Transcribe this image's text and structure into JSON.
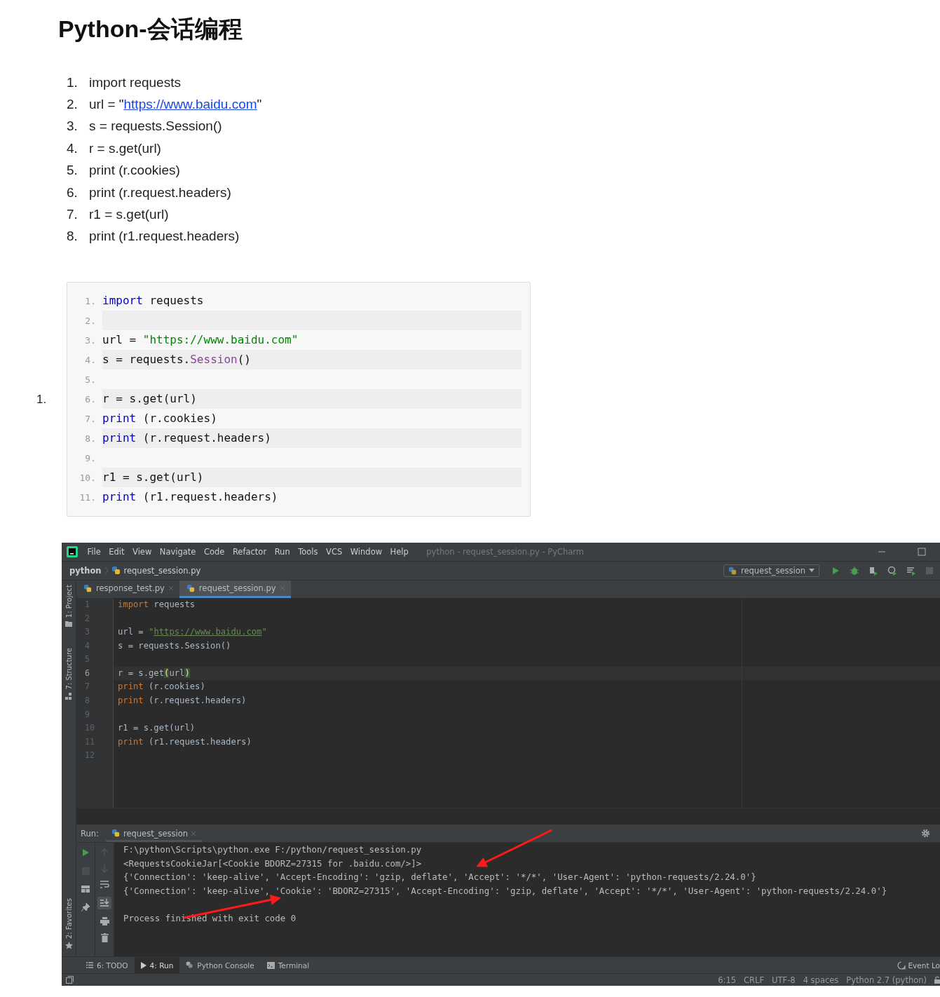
{
  "title": "Python-会话编程",
  "steps": [
    {
      "number": "1.",
      "parts": [
        {
          "kind": "text",
          "text": "import requests"
        }
      ]
    },
    {
      "number": "2.",
      "parts": [
        {
          "kind": "text",
          "text": "url = \""
        },
        {
          "kind": "link",
          "text": "https://www.baidu.com"
        },
        {
          "kind": "text",
          "text": "\""
        }
      ]
    },
    {
      "number": "3.",
      "parts": [
        {
          "kind": "text",
          "text": "s = requests.Session()"
        }
      ]
    },
    {
      "number": "4.",
      "parts": [
        {
          "kind": "text",
          "text": "r = s.get(url)"
        }
      ]
    },
    {
      "number": "5.",
      "parts": [
        {
          "kind": "text",
          "text": "print (r.cookies)"
        }
      ]
    },
    {
      "number": "6.",
      "parts": [
        {
          "kind": "text",
          "text": "print (r.request.headers)"
        }
      ]
    },
    {
      "number": "7.",
      "parts": [
        {
          "kind": "text",
          "text": "r1 = s.get(url)"
        }
      ]
    },
    {
      "number": "8.",
      "parts": [
        {
          "kind": "text",
          "text": "print (r1.request.headers)"
        }
      ]
    }
  ],
  "code_item": {
    "number": "1.",
    "lines": [
      {
        "number": "1.",
        "tokens": [
          {
            "kind": "keyword",
            "text": "import"
          },
          {
            "kind": "plain",
            "text": " requests"
          }
        ]
      },
      {
        "number": "2."
      },
      {
        "number": "3.",
        "tokens": [
          {
            "kind": "plain",
            "text": "url = "
          },
          {
            "kind": "string",
            "text": "\"https://www.baidu.com\""
          }
        ]
      },
      {
        "number": "4.",
        "tokens": [
          {
            "kind": "plain",
            "text": "s = requests."
          },
          {
            "kind": "func",
            "text": "Session"
          },
          {
            "kind": "plain",
            "text": "()"
          }
        ]
      },
      {
        "number": "5."
      },
      {
        "number": "6.",
        "tokens": [
          {
            "kind": "plain",
            "text": "r = s.get(url)"
          }
        ]
      },
      {
        "number": "7.",
        "tokens": [
          {
            "kind": "keyword",
            "text": "print"
          },
          {
            "kind": "plain",
            "text": " (r.cookies)"
          }
        ]
      },
      {
        "number": "8.",
        "tokens": [
          {
            "kind": "keyword",
            "text": "print"
          },
          {
            "kind": "plain",
            "text": " (r.request.headers)"
          }
        ]
      },
      {
        "number": "9."
      },
      {
        "number": "10.",
        "tokens": [
          {
            "kind": "plain",
            "text": "r1 = s.get(url)"
          }
        ]
      },
      {
        "number": "11.",
        "tokens": [
          {
            "kind": "keyword",
            "text": "print"
          },
          {
            "kind": "plain",
            "text": " (r1.request.headers)"
          }
        ]
      }
    ]
  },
  "ide": {
    "menu": [
      "File",
      "Edit",
      "View",
      "Navigate",
      "Code",
      "Refactor",
      "Run",
      "Tools",
      "VCS",
      "Window",
      "Help"
    ],
    "window_title": "python - request_session.py - PyCharm",
    "breadcrumb": {
      "project": "python",
      "file": "request_session.py"
    },
    "run_config": "request_session",
    "tabs": [
      {
        "label": "response_test.py",
        "selected": false
      },
      {
        "label": "request_session.py",
        "selected": true
      }
    ],
    "left_tools": [
      {
        "label": "1: Project",
        "kind": "project"
      },
      {
        "label": "7: Structure",
        "kind": "structure"
      },
      {
        "label": "2: Favorites",
        "kind": "favorites"
      }
    ],
    "editor_lines": [
      {
        "number": "1",
        "current": false,
        "tokens": [
          {
            "kind": "keyword",
            "text": "import"
          },
          {
            "kind": "plain",
            "text": " requests"
          }
        ]
      },
      {
        "number": "2",
        "current": false
      },
      {
        "number": "3",
        "current": false,
        "tokens": [
          {
            "kind": "plain",
            "text": "url = "
          },
          {
            "kind": "string",
            "text": "\""
          },
          {
            "kind": "link",
            "text": "https://www.baidu.com"
          },
          {
            "kind": "string",
            "text": "\""
          }
        ]
      },
      {
        "number": "4",
        "current": false,
        "tokens": [
          {
            "kind": "plain",
            "text": "s = requests.Session()"
          }
        ]
      },
      {
        "number": "5",
        "current": false
      },
      {
        "number": "6",
        "current": true,
        "tokens": [
          {
            "kind": "plain",
            "text": "r = s.get"
          },
          {
            "kind": "brace",
            "text": "("
          },
          {
            "kind": "plain",
            "text": "url"
          },
          {
            "kind": "brace",
            "text": ")"
          }
        ]
      },
      {
        "number": "7",
        "current": false,
        "tokens": [
          {
            "kind": "keyword",
            "text": "print"
          },
          {
            "kind": "plain",
            "text": " (r.cookies)"
          }
        ]
      },
      {
        "number": "8",
        "current": false,
        "tokens": [
          {
            "kind": "keyword",
            "text": "print"
          },
          {
            "kind": "plain",
            "text": " (r.request.headers)"
          }
        ]
      },
      {
        "number": "9",
        "current": false
      },
      {
        "number": "10",
        "current": false,
        "tokens": [
          {
            "kind": "plain",
            "text": "r1 = s.get(url)"
          }
        ]
      },
      {
        "number": "11",
        "current": false,
        "tokens": [
          {
            "kind": "keyword",
            "text": "print"
          },
          {
            "kind": "plain",
            "text": " (r1.request.headers)"
          }
        ]
      },
      {
        "number": "12",
        "current": false
      }
    ],
    "run": {
      "label": "Run:",
      "tab": "request_session",
      "output": [
        "F:\\python\\Scripts\\python.exe F:/python/request_session.py",
        "<RequestsCookieJar[<Cookie BDORZ=27315 for .baidu.com/>]>",
        "{'Connection': 'keep-alive', 'Accept-Encoding': 'gzip, deflate', 'Accept': '*/*', 'User-Agent': 'python-requests/2.24.0'}",
        "{'Connection': 'keep-alive', 'Cookie': 'BDORZ=27315', 'Accept-Encoding': 'gzip, deflate', 'Accept': '*/*', 'User-Agent': 'python-requests/2.24.0'}"
      ],
      "exit_message": "Process finished with exit code 0"
    },
    "tool_tabs": [
      {
        "label": "6: TODO",
        "kind": "todo",
        "selected": false
      },
      {
        "label": "4: Run",
        "kind": "run",
        "selected": true
      },
      {
        "label": "Python Console",
        "kind": "console",
        "selected": false
      },
      {
        "label": "Terminal",
        "kind": "terminal",
        "selected": false
      }
    ],
    "event_log": "Event Lo",
    "status": [
      "6:15",
      "CRLF",
      "UTF-8",
      "4 spaces",
      "Python 2.7 (python)"
    ]
  }
}
